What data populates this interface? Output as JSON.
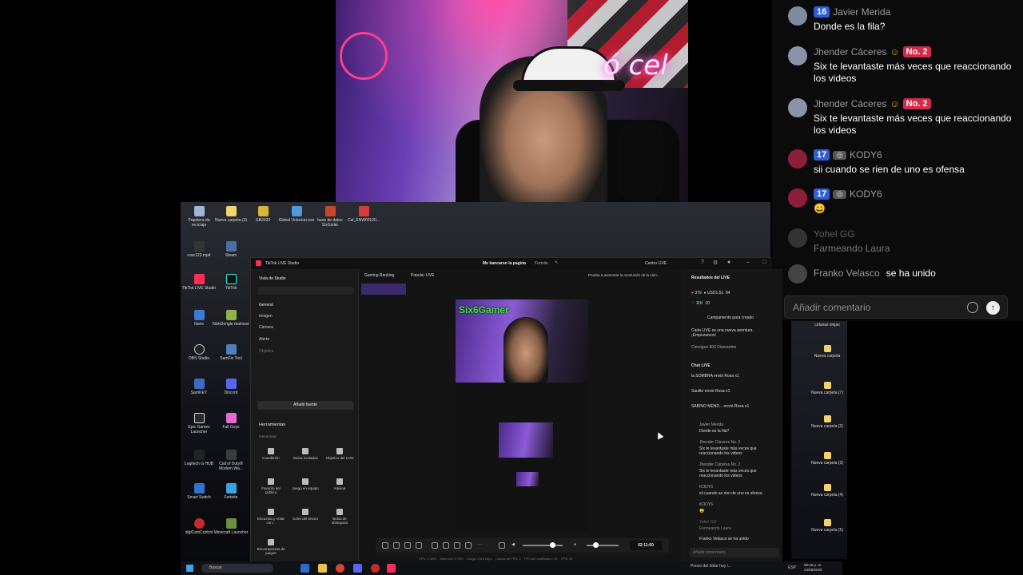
{
  "webcam": {
    "sign_text": "ó cel"
  },
  "overlay_chat": {
    "messages": [
      {
        "level": "16",
        "name": "Javier Merida",
        "rank": "",
        "text": "Donde es la fila?"
      },
      {
        "level": "",
        "name": "Jhender Cáceres",
        "rank": "No. 2",
        "text": "Six te levantaste más veces que reaccionando los videos"
      },
      {
        "level": "",
        "name": "Jhender Cáceres",
        "rank": "No. 2",
        "text": "Six te levantaste más veces que reaccionando los videos"
      },
      {
        "level": "17",
        "name": "KODY6",
        "rank": "",
        "text": "sii cuando se rien de uno es ofensa"
      },
      {
        "level": "17",
        "name": "KODY6",
        "rank": "",
        "text": "😀"
      },
      {
        "level": "",
        "name": "Yohel GG",
        "rank": "",
        "text": "Farmeando Laura"
      },
      {
        "level": "",
        "name": "Franko Velasco",
        "rank": "",
        "text": "se ha unido"
      }
    ],
    "input_placeholder": "Añadir comentario"
  },
  "desktop_icons": [
    "Papelera de reciclaje",
    "Nueva carpeta (3)",
    "GB3420",
    "Global Unlocker.exe",
    "base de datos SixGiolar",
    "Cal_ENW00120...",
    "roac123.mp4",
    "Steam",
    "TikTok LIVE Studio",
    "TikTok",
    "Iliuns",
    "NickDongle mainexe",
    "OBS Studio",
    "SamFix Tool",
    "SamKEY",
    "Discord",
    "Epic Games Launcher",
    "Fall Guys",
    "Logitech G HUB",
    "Call of Duty® Modern Wa...",
    "Smart Switch",
    "Fortnite",
    "digiCamControl",
    "Minecraft Launcher"
  ],
  "desktop_icons_right": [
    "colunas viejas",
    "Nueva carpeta",
    "Nueva carpeta (7)",
    "Nueva carpeta (2)",
    "Nueva carpeta (3)",
    "Nueva carpeta (4)",
    "Nueva carpeta (5)",
    "Nueva carpeta (6)"
  ],
  "studio": {
    "app_title": "TikTok LIVE Studio",
    "stream_title": "Me bancaron la pagina",
    "game": "Fortnite",
    "live_center": "Centro LIVE",
    "left": {
      "view_label": "Vista de Studio",
      "general": "General",
      "sources": [
        "Imagen",
        "Cámara",
        "Alerta",
        "Objetivo"
      ],
      "add_source": "Añadir fuente",
      "tools_title": "Herramientas",
      "interaction": "Interactuar",
      "tools": [
        "Coanfitrión",
        "Varios invitados",
        "Objetivo del LIVE",
        "Favorito del público",
        "Juego en equipo",
        "Adivina",
        "Encuesta y Votar con...",
        "Cofre del tesoro",
        "Bolsa de obsequios",
        "Recompensas de juegos"
      ]
    },
    "canvas": {
      "top_tabs": [
        "Gaming Ranking",
        "Popular LIVE"
      ],
      "tip": "Prueba a aumentar la resolución de la cám...",
      "overlay_name": "Six6Gamer",
      "timer": "02:11:00"
    },
    "right": {
      "results_title": "Resultados del LIVE",
      "stats": [
        "379",
        "USD1.51",
        "84",
        "11K",
        "10"
      ],
      "campaign": "Campamento para creado",
      "adventure": "Cada LIVE es una nueva aventura. ¡Empezamos!",
      "goal": "Consigue 800 Diamantes",
      "chat_title": "Chat LIVE",
      "gifts": [
        "la SOMBRA envió Rosa x1",
        "Saulito envió Rosa x1",
        "SABINO MEND... envió Rosa x1"
      ],
      "messages": [
        "Javier Merida",
        "Donde es la fila?",
        "Jhender Cáceres No. 2",
        "Six te levantaste más veces que reaccionando los videos",
        "Jhender Cáceres No. 2",
        "Six te levantaste más veces que reaccionando los videos",
        "KODY6",
        "sii cuando se rien de uno es ofensa",
        "KODY6",
        "😀",
        "Yohel GG",
        "Farmeando Laura",
        "Franko Velasco se ha unido"
      ],
      "input_placeholder": "Añadir comentario"
    },
    "perf": [
      "CPU: 2.48%",
      "Memoria: 0.78%",
      "Carga: 2318 kbps",
      "Caídas de FPS: 0",
      "FPS del codificador: 30",
      "FPS: 30"
    ]
  },
  "taskbar": {
    "search": "Buscar",
    "news": "Precio del dólar hoy i...",
    "lang": "ESP",
    "time": "00:45 p. m.",
    "date": "24/08/2025"
  },
  "colors": {
    "accent_pink": "#fe2c55",
    "tiktok_blue": "#2f5ed8",
    "green_title": "#36e636"
  }
}
